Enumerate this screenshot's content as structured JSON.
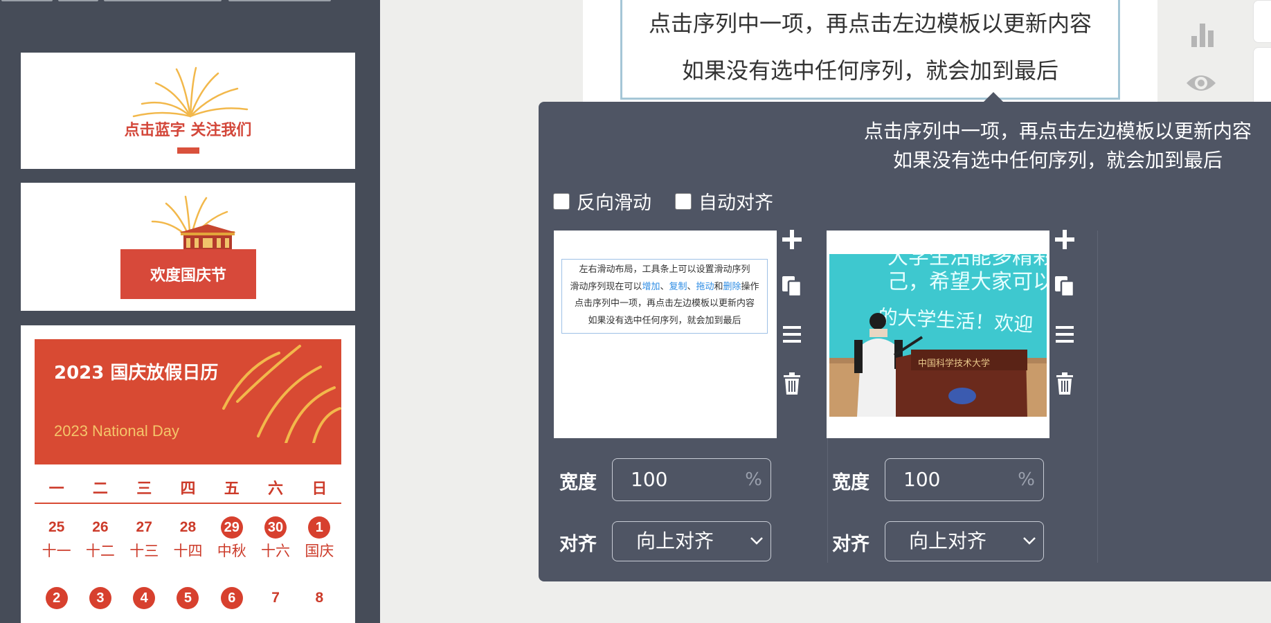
{
  "sidebar": {
    "card1": {
      "text": "点击蓝字 关注我们"
    },
    "card2": {
      "button": "欢度国庆节"
    },
    "calendar": {
      "title": "2023 国庆放假日历",
      "subtitle": "2023 National Day",
      "weekdays": [
        "一",
        "二",
        "三",
        "四",
        "五",
        "六",
        "日"
      ],
      "row1": [
        {
          "num": "25",
          "lunar": "十一",
          "holiday": false
        },
        {
          "num": "26",
          "lunar": "十二",
          "holiday": false
        },
        {
          "num": "27",
          "lunar": "十三",
          "holiday": false
        },
        {
          "num": "28",
          "lunar": "十四",
          "holiday": false
        },
        {
          "num": "29",
          "lunar": "中秋",
          "holiday": true
        },
        {
          "num": "30",
          "lunar": "十六",
          "holiday": true
        },
        {
          "num": "1",
          "lunar": "国庆",
          "holiday": true
        }
      ],
      "row2": [
        {
          "num": "2",
          "holiday": true
        },
        {
          "num": "3",
          "holiday": true
        },
        {
          "num": "4",
          "holiday": true
        },
        {
          "num": "5",
          "holiday": true
        },
        {
          "num": "6",
          "holiday": true
        },
        {
          "num": "7",
          "holiday": false
        },
        {
          "num": "8",
          "holiday": false
        }
      ]
    }
  },
  "editor": {
    "line1": "点击序列中一项，再点击左边模板以更新内容",
    "line2": "如果没有选中任何序列，就会加到最后"
  },
  "popup": {
    "hint_line1": "点击序列中一项，再点击左边模板以更新内容",
    "hint_line2": "如果没有选中任何序列，就会加到最后",
    "reverse_label": "反向滑动",
    "autoalign_label": "自动对齐",
    "slide1": {
      "line1": "左右滑动布局，工具条上可以设置滑动序列",
      "line2_pre": "滑动序列现在可以",
      "add": "增加",
      "sep1": "、",
      "copy": "复制",
      "sep2": "、",
      "drag": "拖动",
      "and": "和",
      "del": "删除",
      "line2_post": "操作",
      "line3": "点击序列中一项，再点击左边模板以更新内容",
      "line4": "如果没有选中任何序列，就会加到最后"
    },
    "slide2": {
      "screen_line1": "大学生活能多精彩",
      "screen_line2": "己，希望大家可以",
      "screen_line3": "的大学生活！欢迎",
      "podium": "中国科学技术大学"
    },
    "width_label": "宽度",
    "width_value": "100",
    "width_unit": "%",
    "align_label": "对齐",
    "align_value": "向上对齐"
  },
  "colors": {
    "sidebar_bg": "#464c58",
    "brand_red": "#d84a33",
    "popup_bg": "#4f5564",
    "link_blue": "#2f8de4"
  }
}
